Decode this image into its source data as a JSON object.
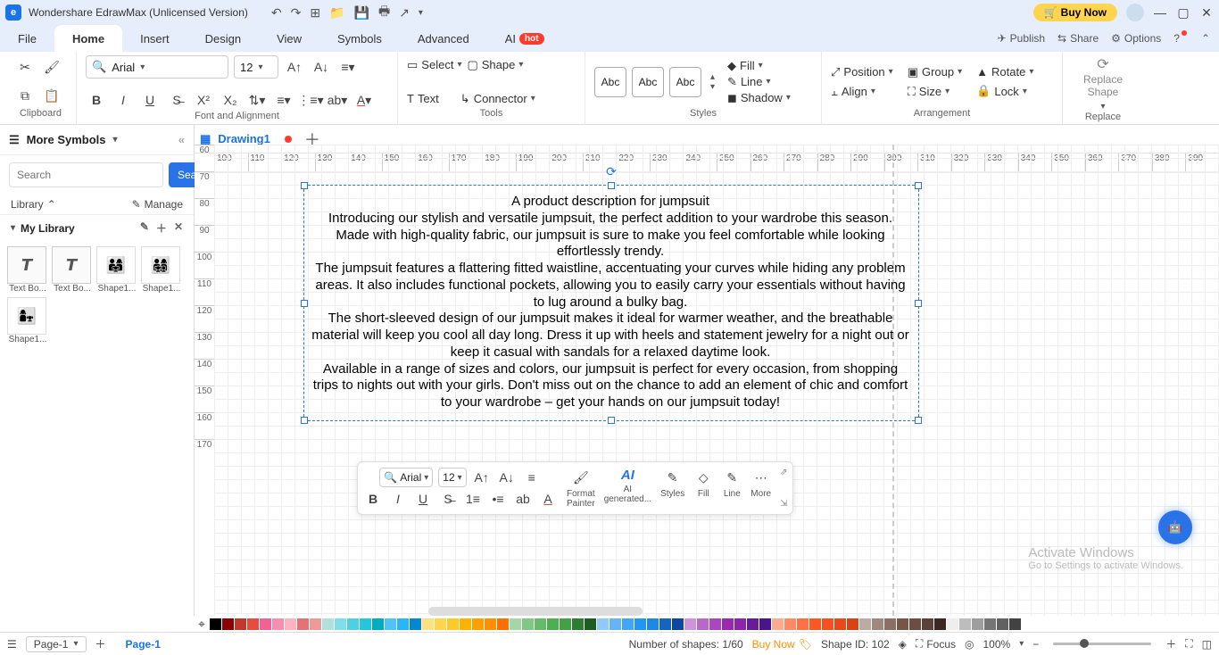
{
  "titlebar": {
    "app_title": "Wondershare EdrawMax (Unlicensed Version)",
    "buy": "Buy Now"
  },
  "menu": {
    "file": "File",
    "home": "Home",
    "insert": "Insert",
    "design": "Design",
    "view": "View",
    "symbols": "Symbols",
    "advanced": "Advanced",
    "ai": "AI",
    "hot": "hot",
    "publish": "Publish",
    "share": "Share",
    "options": "Options"
  },
  "ribbon": {
    "font_name": "Arial",
    "font_size": "12",
    "select": "Select",
    "shape": "Shape",
    "text": "Text",
    "connector": "Connector",
    "fill": "Fill",
    "line": "Line",
    "shadow": "Shadow",
    "position": "Position",
    "align": "Align",
    "group": "Group",
    "size": "Size",
    "rotate": "Rotate",
    "lock": "Lock",
    "replace_shape": "Replace\nShape",
    "abc": "Abc",
    "groups": {
      "clipboard": "Clipboard",
      "font": "Font and Alignment",
      "tools": "Tools",
      "styles": "Styles",
      "arrangement": "Arrangement",
      "replace": "Replace"
    }
  },
  "sidebar": {
    "more": "More Symbols",
    "search_ph": "Search",
    "search_btn": "Search",
    "library": "Library",
    "manage": "Manage",
    "mylib": "My Library",
    "thumbs": [
      "Text Bo...",
      "Text Bo...",
      "Shape1...",
      "Shape1...",
      "Shape1..."
    ]
  },
  "tabs": {
    "drawing": "Drawing1"
  },
  "ruler_h": [
    "100",
    "110",
    "120",
    "130",
    "140",
    "150",
    "160",
    "170",
    "180",
    "190",
    "200",
    "210",
    "220",
    "230",
    "240",
    "250",
    "260",
    "270",
    "280",
    "290",
    "300",
    "310",
    "320",
    "330",
    "340",
    "350",
    "360",
    "370",
    "380",
    "390"
  ],
  "ruler_v": [
    "60",
    "70",
    "80",
    "90",
    "100",
    "110",
    "120",
    "130",
    "140",
    "150",
    "160",
    "170"
  ],
  "text": {
    "title": "A product description for jumpsuit",
    "p1": "Introducing our stylish and versatile jumpsuit, the perfect addition to your wardrobe this season. Made with high-quality fabric, our jumpsuit is sure to make you feel comfortable while looking effortlessly trendy.",
    "p2": "The jumpsuit features a flattering fitted waistline, accentuating your curves while hiding any problem areas. It also includes functional pockets, allowing you to easily carry your essentials without having to lug around a bulky bag.",
    "p3": "The short-sleeved design of our jumpsuit makes it ideal for warmer weather, and the breathable material will keep you cool all day long. Dress it up with heels and statement jewelry for a night out or keep it casual with sandals for a relaxed daytime look.",
    "p4": "Available in a range of sizes and colors, our jumpsuit is perfect for every occasion, from shopping trips to nights out with your girls. Don't miss out on the chance to add an element of chic and comfort to your wardrobe – get your hands on our jumpsuit today!"
  },
  "mini": {
    "font": "Arial",
    "size": "12",
    "format_painter": "Format\nPainter",
    "ai_gen": "AI\ngenerated...",
    "styles": "Styles",
    "fill": "Fill",
    "line": "Line",
    "more": "More"
  },
  "status": {
    "page_sel": "Page-1",
    "page_tab": "Page-1",
    "shapes": "Number of shapes: 1/60",
    "buy_now": "Buy Now",
    "shape_id": "Shape ID: 102",
    "focus": "Focus",
    "zoom": "100%"
  },
  "watermark": {
    "l1": "Activate Windows",
    "l2": "Go to Settings to activate Windows."
  },
  "colors": [
    "#000",
    "#8b0000",
    "#c0392b",
    "#e74c3c",
    "#f06292",
    "#f48fb1",
    "#ffb3c1",
    "#e57373",
    "#ef9a9a",
    "#b2dfdb",
    "#80deea",
    "#4dd0e1",
    "#26c6da",
    "#00acc1",
    "#4fc3f7",
    "#29b6f6",
    "#0288d1",
    "#ffe082",
    "#ffd54f",
    "#ffca28",
    "#ffb300",
    "#ffa000",
    "#ff8f00",
    "#ff6f00",
    "#a5d6a7",
    "#81c784",
    "#66bb6a",
    "#4caf50",
    "#43a047",
    "#2e7d32",
    "#1b5e20",
    "#90caf9",
    "#64b5f6",
    "#42a5f5",
    "#2196f3",
    "#1e88e5",
    "#1565c0",
    "#0d47a1",
    "#ce93d8",
    "#ba68c8",
    "#ab47bc",
    "#9c27b0",
    "#8e24aa",
    "#6a1b9a",
    "#4a148c",
    "#ffab91",
    "#ff8a65",
    "#ff7043",
    "#ff5722",
    "#f4511e",
    "#e64a19",
    "#d84315",
    "#bcaaa4",
    "#a1887f",
    "#8d6e63",
    "#795548",
    "#6d4c41",
    "#5d4037",
    "#3e2723",
    "#eeeeee",
    "#bdbdbd",
    "#9e9e9e",
    "#757575",
    "#616161",
    "#424242"
  ]
}
